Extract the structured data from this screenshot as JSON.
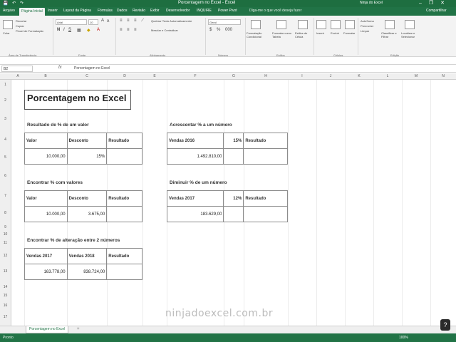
{
  "window": {
    "title": "Porcentagem no Excel - Excel",
    "user": "Ninja do Excel",
    "controls": [
      "–",
      "❐",
      "✕"
    ]
  },
  "tabs": [
    "Arquivo",
    "Página Inicial",
    "Inserir",
    "Layout da Página",
    "Fórmulas",
    "Dados",
    "Revisão",
    "Exibir",
    "Desenvolvedor",
    "INQUIRE",
    "Power Pivot"
  ],
  "tell_me": "Diga-me o que você deseja fazer",
  "share": "Compartilhar",
  "ribbon": {
    "clipboard": {
      "label": "Área de Transferência",
      "paste": "Colar",
      "cut": "Recortar",
      "copy": "Copiar",
      "format_painter": "Pincel de Formatação"
    },
    "font": {
      "label": "Fonte",
      "name": "Arial",
      "size": "10"
    },
    "alignment": {
      "label": "Alinhamento",
      "wrap": "Quebrar Texto Automaticamente",
      "merge": "Mesclar e Centralizar"
    },
    "number": {
      "label": "Número",
      "format": "Geral"
    },
    "styles": {
      "label": "Estilos",
      "cond": "Formatação Condicional",
      "table": "Formatar como Tabela",
      "cell": "Estilos de Célula"
    },
    "cells": {
      "label": "Células",
      "insert": "Inserir",
      "delete": "Excluir",
      "format": "Formatar"
    },
    "editing": {
      "label": "Edição",
      "autosum": "AutoSoma",
      "fill": "Preencher",
      "clear": "Limpar",
      "sort": "Classificar e Filtrar",
      "find": "Localizar e Selecionar"
    }
  },
  "formula_bar": {
    "name_box": "B2",
    "fx": "fx",
    "content": "Porcentagem no Excel"
  },
  "columns": [
    "A",
    "B",
    "C",
    "D",
    "E",
    "F",
    "G",
    "H",
    "I",
    "J",
    "K",
    "L",
    "M",
    "N"
  ],
  "rows": [
    "1",
    "2",
    "3",
    "4",
    "5",
    "6",
    "7",
    "8",
    "9",
    "10",
    "11",
    "12",
    "13",
    "14",
    "15",
    "16",
    "17"
  ],
  "sheet": {
    "title": "Porcentagem no Excel",
    "sections": {
      "s1": {
        "title": "Resultado de % de um valor",
        "headers": [
          "Valor",
          "Desconto",
          "Resultado"
        ],
        "row": [
          "10.000,00",
          "15%",
          ""
        ]
      },
      "s2": {
        "title": "Acrescentar % a um número",
        "headers": [
          "Vendas 2016",
          "15%",
          "Resultado"
        ],
        "row": [
          "1.492.810,00",
          "",
          ""
        ]
      },
      "s3": {
        "title": "Encontrar % com valores",
        "headers": [
          "Valor",
          "Desconto",
          "Resultado"
        ],
        "row": [
          "10.000,00",
          "3.675,00",
          ""
        ]
      },
      "s4": {
        "title": "Diminuir % de um número",
        "headers": [
          "Vendas 2017",
          "12%",
          "Resultado"
        ],
        "row": [
          "183.629,00",
          "",
          ""
        ]
      },
      "s5": {
        "title": "Encontrar % de alteração entre 2 números",
        "headers": [
          "Vendas 2017",
          "Vendas 2018",
          "Resultado"
        ],
        "row": [
          "163.778,00",
          "838.724,00",
          ""
        ]
      }
    }
  },
  "watermark": "ninjadoexcel.com.br",
  "sheet_tab": "Porcentagem no Excel",
  "add_sheet": "+",
  "status": {
    "ready": "Pronto",
    "zoom": "100%"
  },
  "help": "?"
}
